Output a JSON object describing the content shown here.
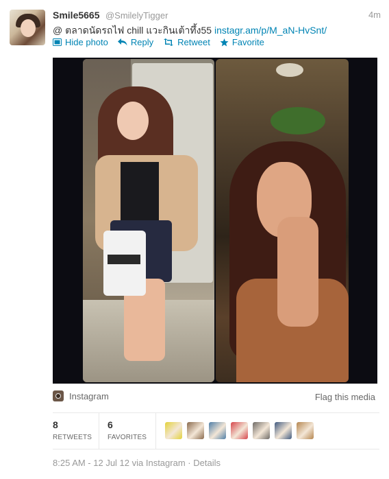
{
  "tweet": {
    "display_name": "Smile5665",
    "handle": "@SmilelyTigger",
    "time": "4m",
    "text_prefix": "@ ตลาดนัดรถไฟ chill แวะกินเต้าทึ้ง55",
    "link_text": "instagr.am/p/M_aN-HvSnt/",
    "actions": {
      "hide_photo": "Hide photo",
      "reply": "Reply",
      "retweet": "Retweet",
      "favorite": "Favorite"
    },
    "media": {
      "source": "Instagram",
      "flag": "Flag this media"
    },
    "stats": {
      "retweets_count": "8",
      "retweets_label": "RETWEETS",
      "favorites_count": "6",
      "favorites_label": "FAVORITES"
    },
    "footer": {
      "timestamp": "8:25 AM - 12 Jul 12 via Instagram",
      "separator": "·",
      "details": "Details"
    }
  },
  "colors": {
    "link": "#0084b4",
    "text": "#333333",
    "muted": "#999999"
  },
  "icons": [
    "photo-icon",
    "reply-icon",
    "retweet-icon",
    "star-icon",
    "instagram-icon"
  ],
  "favoriters": [
    {
      "name": "favoriter-1",
      "color": "#e3d23a"
    },
    {
      "name": "favoriter-2",
      "color": "#8a6a4d"
    },
    {
      "name": "favoriter-3",
      "color": "#4f7fa8"
    },
    {
      "name": "favoriter-4",
      "color": "#d6454b"
    },
    {
      "name": "favoriter-5",
      "color": "#6e6a66"
    },
    {
      "name": "favoriter-6",
      "color": "#405a80"
    },
    {
      "name": "favoriter-7",
      "color": "#b5864f"
    }
  ]
}
